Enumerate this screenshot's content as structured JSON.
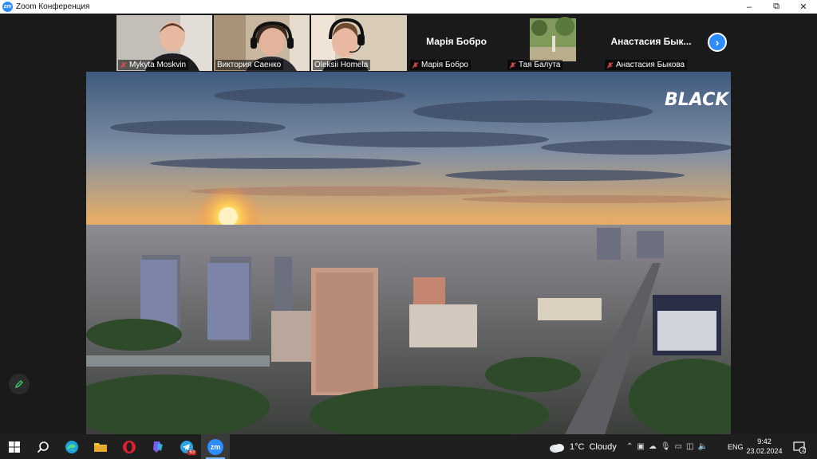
{
  "window": {
    "title": "Zoom Конференция",
    "app_icon_text": "zm",
    "controls": {
      "minimize": "–",
      "restore": "⧉",
      "close": "✕"
    }
  },
  "participants": [
    {
      "name": "Mykyta Moskvin",
      "video": true,
      "muted": true
    },
    {
      "name": "Виктория Саенко",
      "video": true,
      "muted": false
    },
    {
      "name": "Oleksii Homela",
      "video": true,
      "muted": false
    },
    {
      "name": "Марія Бобро",
      "video": false,
      "muted": true,
      "display_name": "Марія Бобро"
    },
    {
      "name": "Тая Балута",
      "video": true,
      "muted": true
    },
    {
      "name": "Анастасия Быкова",
      "video": false,
      "muted": true,
      "display_name": "Анастасия  Бык..."
    }
  ],
  "next_page_icon": "chevron-right-icon",
  "shared_screen": {
    "description_icon": "city-sunset-image",
    "watermark": "BLACK"
  },
  "annotate_icon": "pencil-icon",
  "taskbar": {
    "apps": [
      "windows-start",
      "search",
      "edge",
      "file-explorer",
      "opera",
      "copilot",
      "telegram",
      "zoom"
    ],
    "telegram_badge": "63",
    "zoom_label": "zm",
    "weather": {
      "temp": "1°C",
      "condition": "Cloudy"
    },
    "language": "ENG",
    "time": "9:42",
    "date": "23.02.2024",
    "notifications": "2"
  },
  "colors": {
    "accent": "#2d8cff",
    "muted_icon": "#e04a4a",
    "taskbar": "#1f1f1f",
    "meeting_bg": "#1a1a1a"
  }
}
